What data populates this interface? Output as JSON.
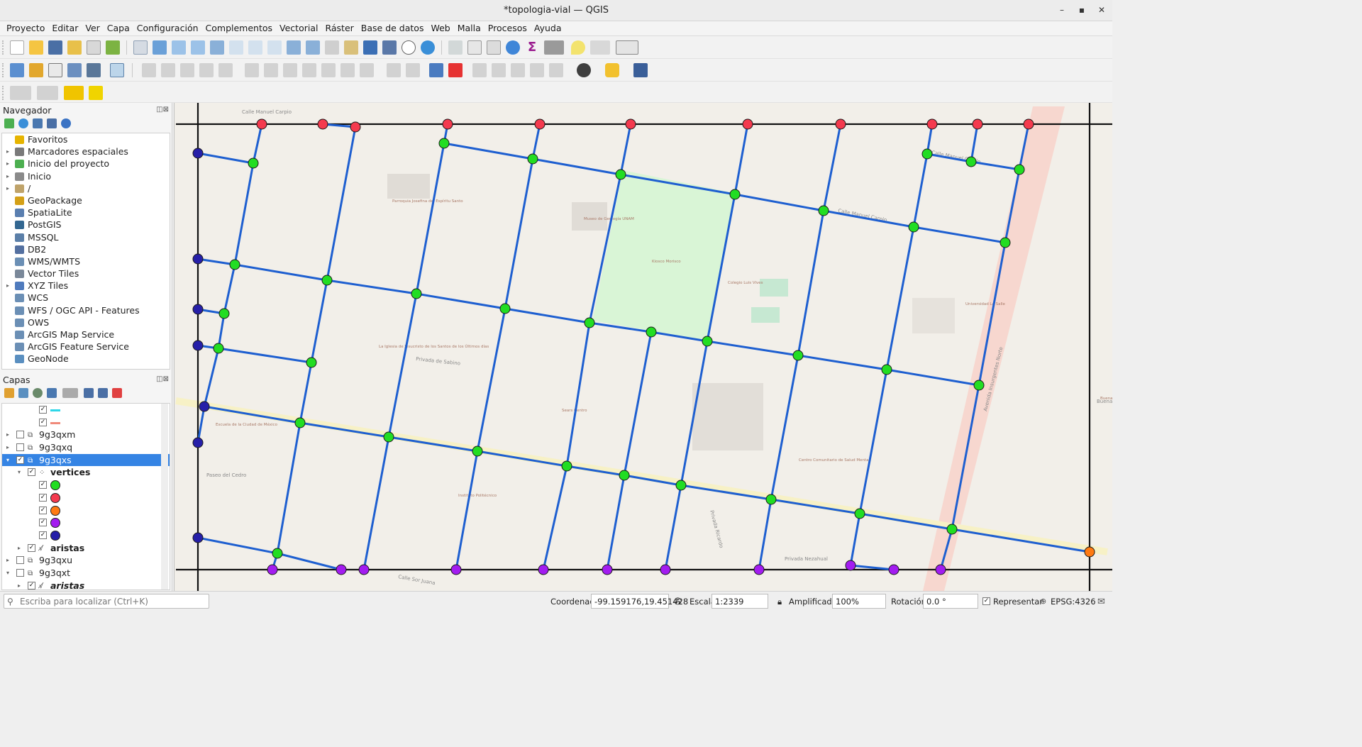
{
  "window": {
    "title": "*topologia-vial — QGIS",
    "controls": [
      "–",
      "▪",
      "✕"
    ]
  },
  "menu": [
    "Proyecto",
    "Editar",
    "Ver",
    "Capa",
    "Configuración",
    "Complementos",
    "Vectorial",
    "Ráster",
    "Base de datos",
    "Web",
    "Malla",
    "Procesos",
    "Ayuda"
  ],
  "navigator": {
    "title": "Navegador",
    "items": [
      {
        "label": "Favoritos",
        "icon": "star-icon",
        "color": "#e6b400",
        "expand": false
      },
      {
        "label": "Marcadores espaciales",
        "icon": "bookmark-icon",
        "color": "#7a7a7a",
        "expand": true
      },
      {
        "label": "Inicio del proyecto",
        "icon": "qgis-project-icon",
        "color": "#4caf50",
        "expand": true
      },
      {
        "label": "Inicio",
        "icon": "home-icon",
        "color": "#8a8a8a",
        "expand": true
      },
      {
        "label": "/",
        "icon": "folder-icon",
        "color": "#bfa36a",
        "expand": true
      },
      {
        "label": "GeoPackage",
        "icon": "geopackage-icon",
        "color": "#d4a017",
        "expand": false
      },
      {
        "label": "SpatiaLite",
        "icon": "spatialite-icon",
        "color": "#5a7fb0",
        "expand": false
      },
      {
        "label": "PostGIS",
        "icon": "postgis-icon",
        "color": "#336791",
        "expand": false
      },
      {
        "label": "MSSQL",
        "icon": "mssql-icon",
        "color": "#5b7fa8",
        "expand": false
      },
      {
        "label": "DB2",
        "icon": "db2-icon",
        "color": "#5470a0",
        "expand": false
      },
      {
        "label": "WMS/WMTS",
        "icon": "globe-icon",
        "color": "#6b8fb5",
        "expand": false
      },
      {
        "label": "Vector Tiles",
        "icon": "grid-icon",
        "color": "#7a8899",
        "expand": false
      },
      {
        "label": "XYZ Tiles",
        "icon": "tiles-icon",
        "color": "#4f7bbd",
        "expand": true
      },
      {
        "label": "WCS",
        "icon": "globe-icon",
        "color": "#6b8fb5",
        "expand": false
      },
      {
        "label": "WFS / OGC API - Features",
        "icon": "globe-icon",
        "color": "#6b8fb5",
        "expand": false
      },
      {
        "label": "OWS",
        "icon": "globe-icon",
        "color": "#6b8fb5",
        "expand": false
      },
      {
        "label": "ArcGIS Map Service",
        "icon": "globe-icon",
        "color": "#6b8fb5",
        "expand": false
      },
      {
        "label": "ArcGIS Feature Service",
        "icon": "globe-icon",
        "color": "#6b8fb5",
        "expand": false
      },
      {
        "label": "GeoNode",
        "icon": "geonode-icon",
        "color": "#5a8fc0",
        "expand": false
      }
    ]
  },
  "layers": {
    "title": "Capas",
    "rows": [
      {
        "label": "",
        "indent": 2,
        "checked": true,
        "symbol": "line",
        "color": "#2ed7e8"
      },
      {
        "label": "",
        "indent": 2,
        "checked": true,
        "symbol": "line",
        "color": "#f08a7a"
      },
      {
        "label": "9g3qxm",
        "indent": 0,
        "checked": false,
        "expand": "▸",
        "symbol": "group"
      },
      {
        "label": "9g3qxq",
        "indent": 0,
        "checked": false,
        "expand": "▸",
        "symbol": "group"
      },
      {
        "label": "9g3qxs",
        "indent": 0,
        "checked": true,
        "expand": "▾",
        "symbol": "group",
        "selected": true
      },
      {
        "label": "vertices",
        "indent": 1,
        "checked": true,
        "expand": "▾",
        "symbol": "points",
        "bold": true
      },
      {
        "label": "",
        "indent": 2,
        "checked": true,
        "symbol": "dot",
        "color": "#22dd22"
      },
      {
        "label": "",
        "indent": 2,
        "checked": true,
        "symbol": "dot",
        "color": "#f43a4e"
      },
      {
        "label": "",
        "indent": 2,
        "checked": true,
        "symbol": "dot",
        "color": "#ff7a12"
      },
      {
        "label": "",
        "indent": 2,
        "checked": true,
        "symbol": "dot",
        "color": "#a31cf0"
      },
      {
        "label": "",
        "indent": 2,
        "checked": true,
        "symbol": "dot",
        "color": "#261fa8"
      },
      {
        "label": "aristas",
        "indent": 1,
        "checked": true,
        "expand": "▸",
        "symbol": "lines",
        "bold": true
      },
      {
        "label": "9g3qxu",
        "indent": 0,
        "checked": false,
        "expand": "▸",
        "symbol": "group"
      },
      {
        "label": "9g3qxt",
        "indent": 0,
        "checked": false,
        "expand": "▾",
        "symbol": "group"
      },
      {
        "label": "aristas",
        "indent": 1,
        "checked": true,
        "expand": "▸",
        "symbol": "lines",
        "italic": true
      }
    ]
  },
  "status": {
    "locator_placeholder": "Escriba para localizar (Ctrl+K)",
    "coord_label": "Coordenada",
    "coord_value": "-99.159176,19.451428",
    "scale_label": "Escala",
    "scale_value": "1:2339",
    "magnifier_label": "Amplificador",
    "magnifier_value": "100%",
    "rotation_label": "Rotación",
    "rotation_value": "0.0 °",
    "render_label": "Representar",
    "crs": "EPSG:4326"
  },
  "map": {
    "colors": {
      "edge": "#1e5fd0",
      "green": "#22dd22",
      "red": "#f43a4e",
      "orange": "#ff7a12",
      "purple": "#a31cf0",
      "navy": "#261fa8",
      "frame": "#111111"
    },
    "street_labels": [
      "Calle Manuel Carpio",
      "Calle Manuel Carpio",
      "Calle Manuel Carpio",
      "Privada de Sabino",
      "Paseo del Cedro",
      "Privada Ricardo",
      "Privada Nezahual",
      "Calle Sor Juana",
      "Avenida Insurgentes Norte",
      "Buenavista"
    ],
    "poi_labels": [
      "Parroquia Josefina del Espíritu Santo",
      "Museo de Geología UNAM",
      "Kiosco Morisco",
      "La Iglesia de Jesucristo de los Santos de los Últimos días",
      "Sears Centro",
      "Centro Comunitario de Salud Mental",
      "Escuela de la Ciudad de México",
      "Instituto Politécnico",
      "Universidad La Salle",
      "Colegio Luis Vives",
      "Buenavista"
    ]
  }
}
